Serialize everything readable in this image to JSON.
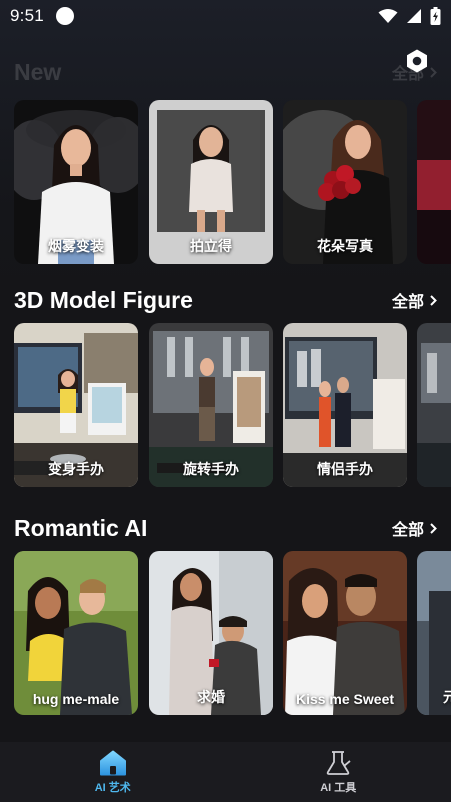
{
  "status_bar": {
    "time": "9:51"
  },
  "sections": [
    {
      "title": "New",
      "see_all": "全部",
      "cards": [
        {
          "label": "烟雾变装"
        },
        {
          "label": "拍立得"
        },
        {
          "label": "花朵写真"
        },
        {
          "label": ""
        }
      ]
    },
    {
      "title": "3D Model Figure",
      "see_all": "全部",
      "cards": [
        {
          "label": "变身手办"
        },
        {
          "label": "旋转手办"
        },
        {
          "label": "情侣手办"
        },
        {
          "label": ""
        }
      ]
    },
    {
      "title": "Romantic AI",
      "see_all": "全部",
      "cards": [
        {
          "label": "hug me-male"
        },
        {
          "label": "求婚"
        },
        {
          "label": "Kiss me Sweet"
        },
        {
          "label": "元"
        }
      ]
    }
  ],
  "bottom_nav": [
    {
      "label": "AI 艺术",
      "icon": "home-icon",
      "active": true
    },
    {
      "label": "AI 工具",
      "icon": "flask-icon",
      "active": false
    }
  ],
  "colors": {
    "accent": "#4fb8ee",
    "background": "#151518",
    "nav_background": "#1b1b1f"
  }
}
